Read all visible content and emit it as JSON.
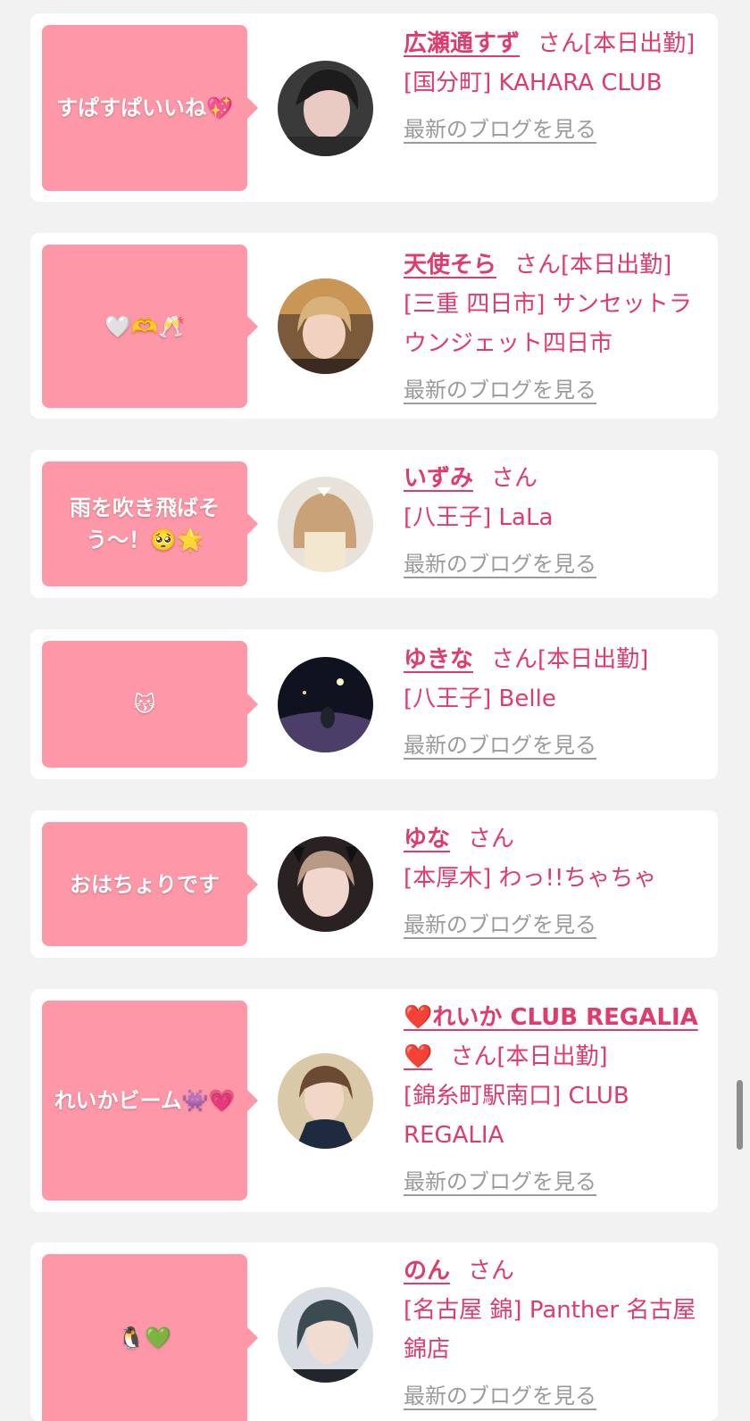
{
  "entries": [
    {
      "message": "すぱすぱいいね💖",
      "name": "広瀬通すず",
      "suffix": "さん",
      "status": "[本日出勤]",
      "shop": "[国分町] KAHARA CLUB",
      "blog_link": "最新のブログを見る"
    },
    {
      "message": "🤍🫶🥂",
      "name": "天使そら",
      "suffix": "さん",
      "status": "[本日出勤]",
      "shop": "[三重 四日市] サンセットラウンジェット四日市",
      "blog_link": "最新のブログを見る"
    },
    {
      "message": "雨を吹き飛ばそう〜！🥺🌟",
      "name": "いずみ",
      "suffix": "さん",
      "status": "",
      "shop": "[八王子] LaLa",
      "blog_link": "最新のブログを見る"
    },
    {
      "message": "😽",
      "name": "ゆきな",
      "suffix": "さん",
      "status": "[本日出勤]",
      "shop": "[八王子] Belle",
      "blog_link": "最新のブログを見る"
    },
    {
      "message": "おはちょりです",
      "name": "ゆな",
      "suffix": "さん",
      "status": "",
      "shop": "[本厚木] わっ!!ちゃちゃ",
      "blog_link": "最新のブログを見る"
    },
    {
      "message": "れいかビーム👾💗",
      "name": "❤️れいか CLUB REGALIA❤️",
      "suffix": "さん",
      "status": "[本日出勤]",
      "shop": "[錦糸町駅南口] CLUB REGALIA",
      "blog_link": "最新のブログを見る"
    },
    {
      "message": "🐧💚",
      "name": "のん",
      "suffix": "さん",
      "status": "",
      "shop": "[名古屋 錦] Panther 名古屋錦店",
      "blog_link": "最新のブログを見る"
    }
  ],
  "colors": {
    "background": "#f2f2f2",
    "bubble": "#fe97a8",
    "accent_text": "#e03b6b",
    "link_gray": "#9b9b9b"
  }
}
